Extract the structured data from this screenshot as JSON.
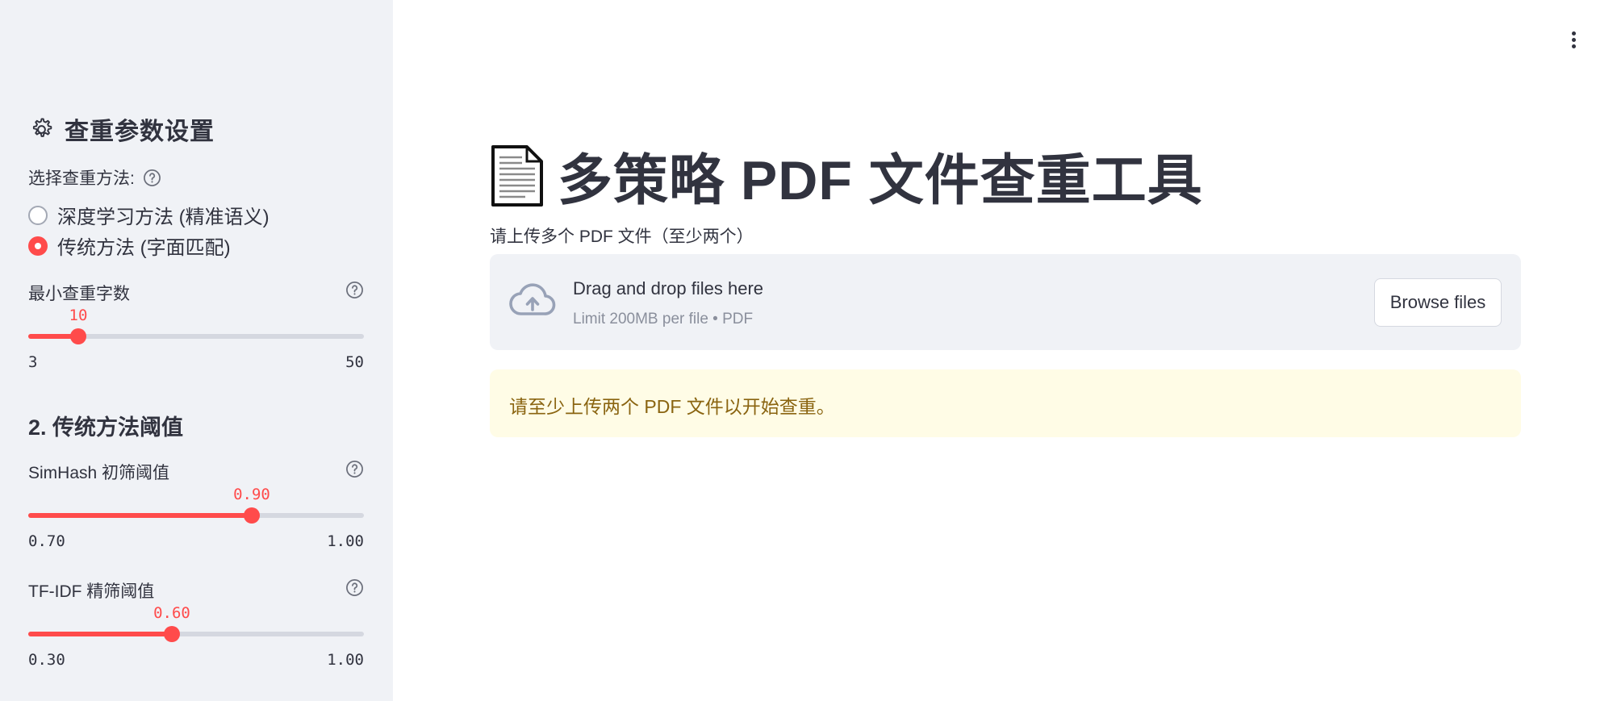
{
  "sidebar": {
    "header_title": "查重参数设置",
    "method_label": "选择查重方法:",
    "methods": [
      {
        "label": "深度学习方法 (精准语义)",
        "checked": false
      },
      {
        "label": "传统方法 (字面匹配)",
        "checked": true
      }
    ],
    "min_chars": {
      "label": "最小查重字数",
      "value": "10",
      "min": "3",
      "max": "50",
      "fraction": 0.149
    },
    "section_title": "2. 传统方法阈值",
    "simhash": {
      "label": "SimHash 初筛阈值",
      "value": "0.90",
      "min": "0.70",
      "max": "1.00",
      "fraction": 0.667
    },
    "tfidf": {
      "label": "TF-IDF 精筛阈值",
      "value": "0.60",
      "min": "0.30",
      "max": "1.00",
      "fraction": 0.429
    }
  },
  "main": {
    "title": "多策略 PDF 文件查重工具",
    "upload_label": "请上传多个 PDF 文件（至少两个）",
    "dropzone": {
      "title": "Drag and drop files here",
      "subtitle": "Limit 200MB per file • PDF",
      "browse_label": "Browse files"
    },
    "warning": "请至少上传两个 PDF 文件以开始查重。"
  },
  "colors": {
    "accent": "#ff4b4b",
    "sidebar_bg": "#f0f2f6",
    "warning_bg": "#fffce6",
    "warning_text": "#8a6410"
  },
  "icons": [
    "gear-icon",
    "help-icon",
    "document-icon",
    "cloud-upload-icon",
    "more-vert-icon"
  ]
}
